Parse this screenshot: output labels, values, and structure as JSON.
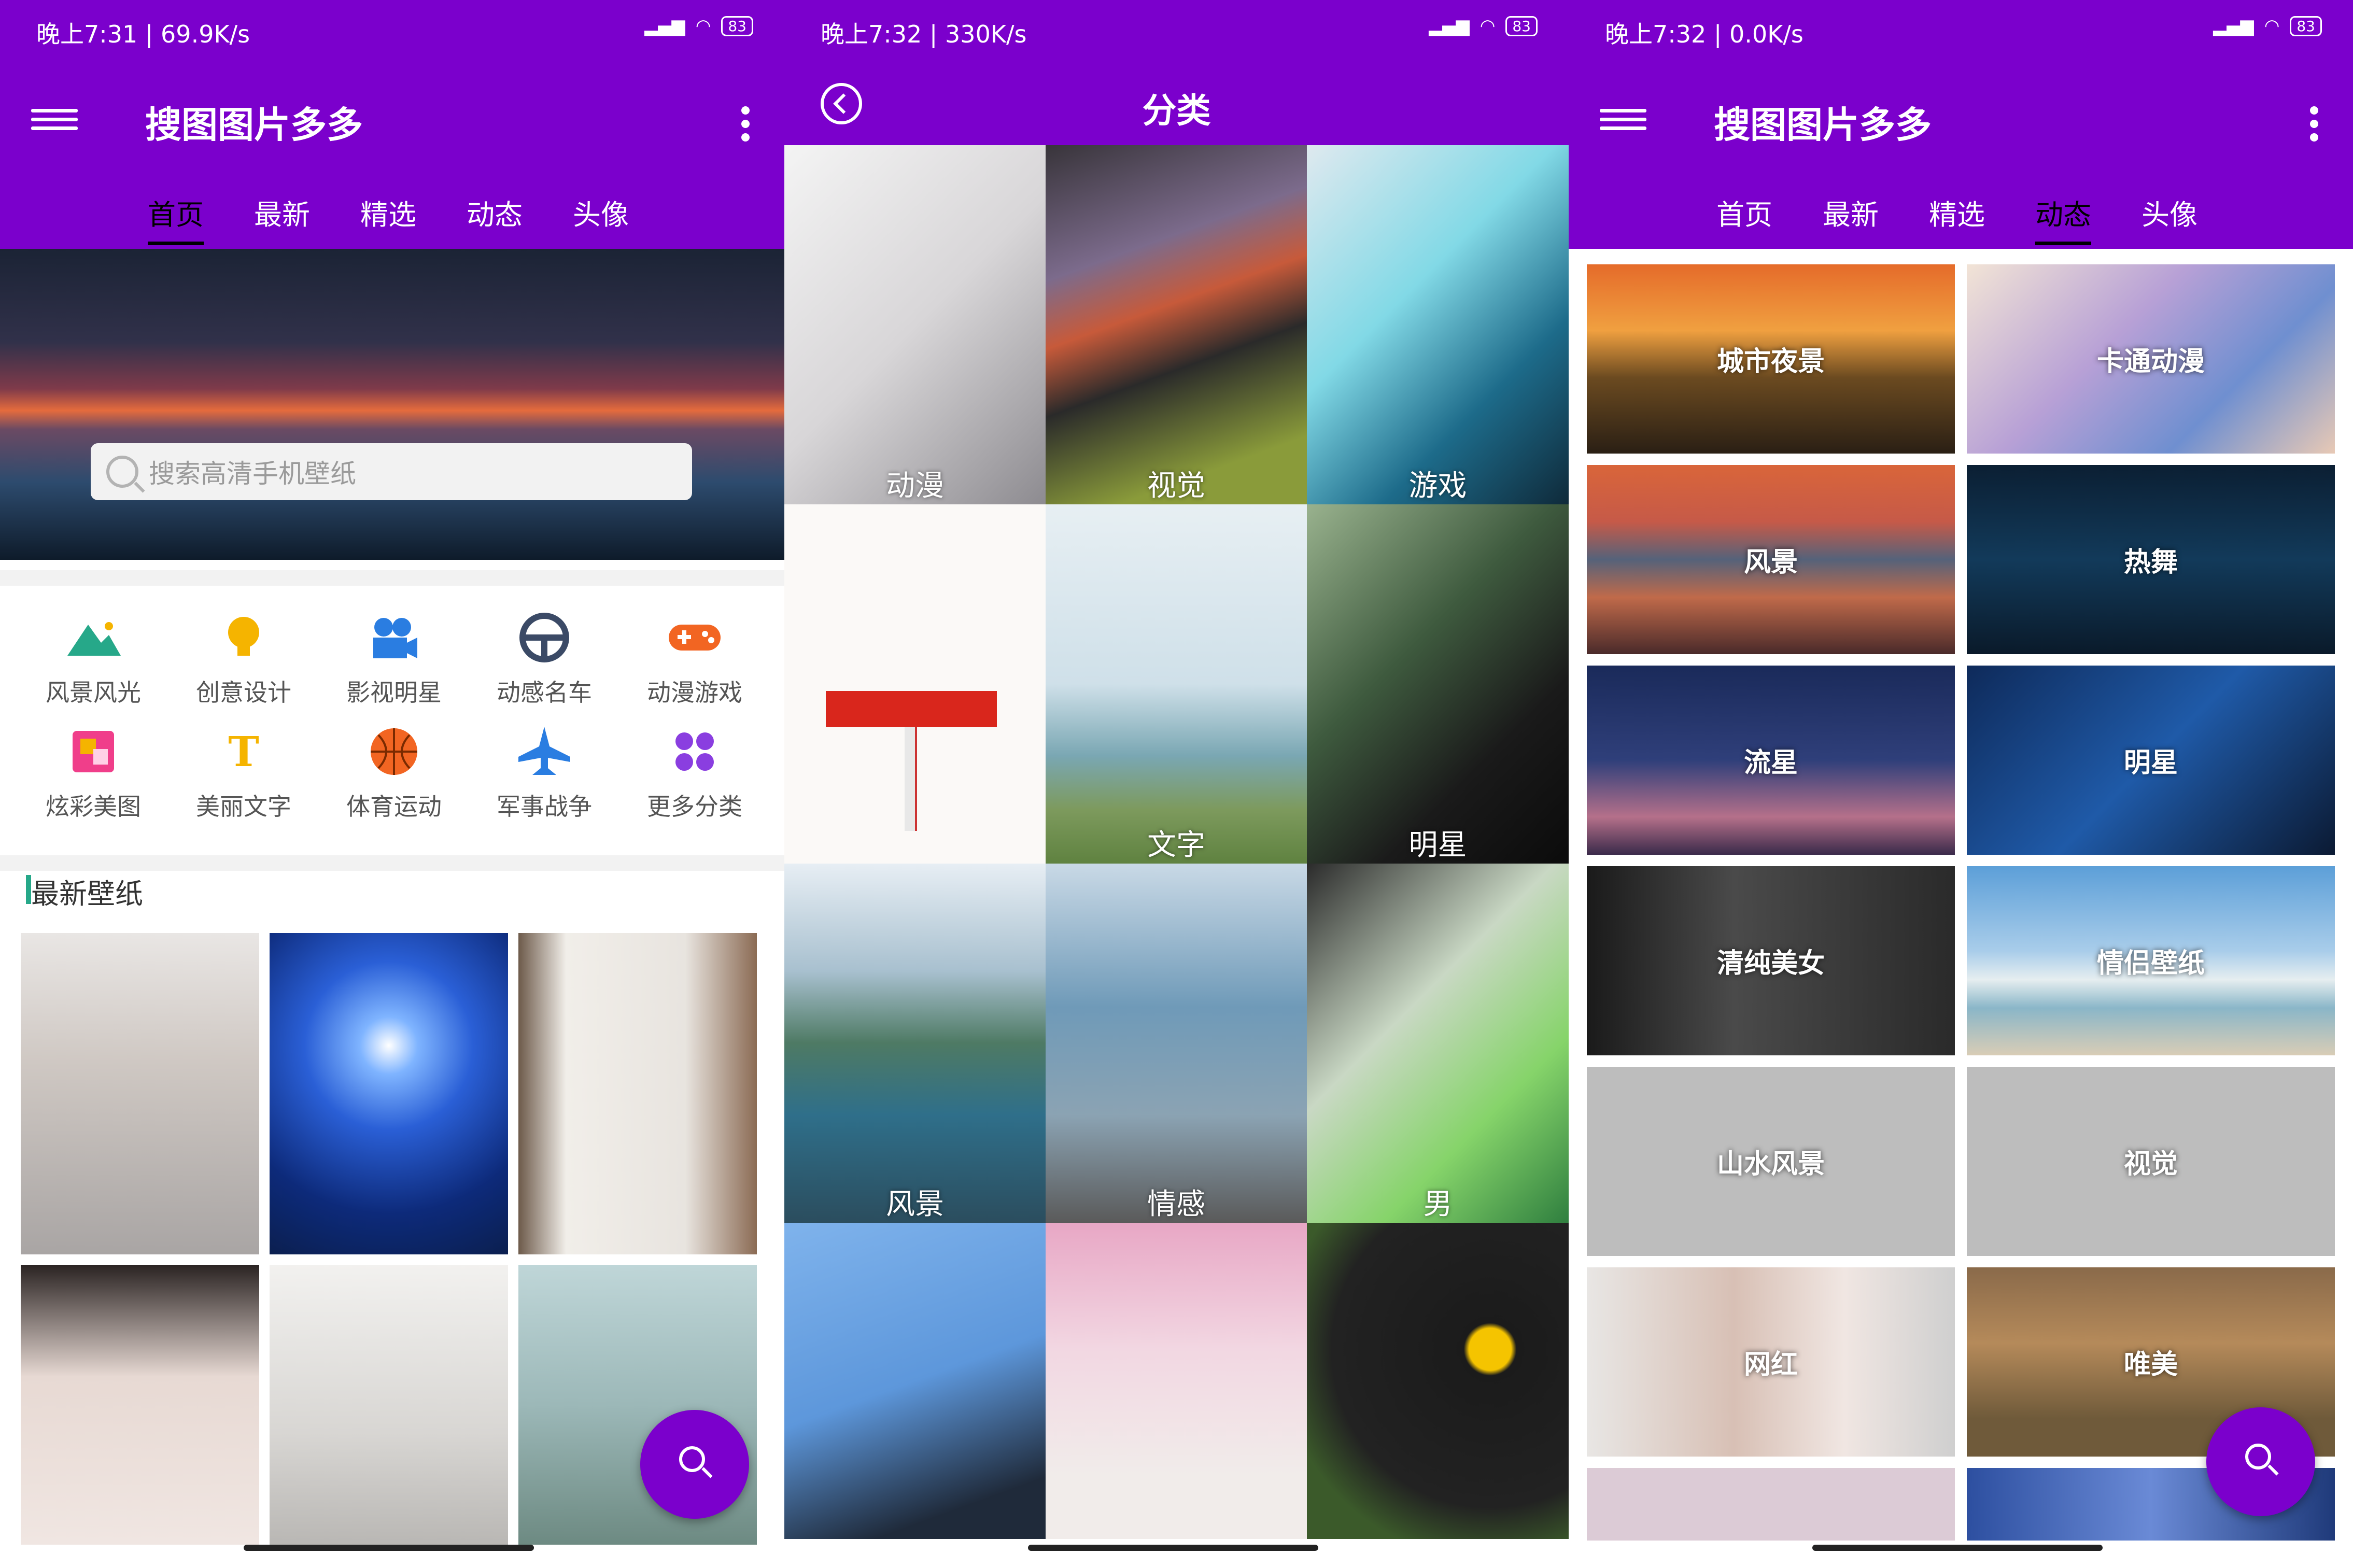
{
  "screens": [
    {
      "status": {
        "time": "晚上7:31 | 69.9K/s",
        "battery": "83"
      },
      "app_title": "搜图图片多多",
      "tabs": [
        "首页",
        "最新",
        "精选",
        "动态",
        "头像"
      ],
      "active_tab": 0,
      "search_placeholder": "搜索高清手机壁纸",
      "categories": [
        {
          "label": "风景风光",
          "icon": "mountain-icon",
          "color": "#26a889"
        },
        {
          "label": "创意设计",
          "icon": "lightbulb-icon",
          "color": "#f5b400"
        },
        {
          "label": "影视明星",
          "icon": "movie-camera-icon",
          "color": "#2a7de1"
        },
        {
          "label": "动感名车",
          "icon": "steering-wheel-icon",
          "color": "#3b4a66"
        },
        {
          "label": "动漫游戏",
          "icon": "gamepad-icon",
          "color": "#f26522"
        },
        {
          "label": "炫彩美图",
          "icon": "color-square-icon",
          "color": "#f03e8a"
        },
        {
          "label": "美丽文字",
          "icon": "text-t-icon",
          "color": "#f5b400"
        },
        {
          "label": "体育运动",
          "icon": "basketball-icon",
          "color": "#f26522"
        },
        {
          "label": "军事战争",
          "icon": "jet-icon",
          "color": "#2a7de1"
        },
        {
          "label": "更多分类",
          "icon": "four-dots-icon",
          "color": "#8a3ee0"
        }
      ],
      "section_title": "最新壁纸"
    },
    {
      "status": {
        "time": "晚上7:32 | 330K/s",
        "battery": "83"
      },
      "title": "分类",
      "tiles": [
        "动漫",
        "视觉",
        "游戏",
        "",
        "文字",
        "明星",
        "风景",
        "情感",
        "男",
        "",
        "",
        ""
      ]
    },
    {
      "status": {
        "time": "晚上7:32 | 0.0K/s",
        "battery": "83"
      },
      "app_title": "搜图图片多多",
      "tabs": [
        "首页",
        "最新",
        "精选",
        "动态",
        "头像"
      ],
      "active_tab": 3,
      "tiles": [
        "城市夜景",
        "卡通动漫",
        "风景",
        "热舞",
        "流星",
        "明星",
        "清纯美女",
        "情侣壁纸",
        "山水风景",
        "视觉",
        "网红",
        "唯美"
      ]
    }
  ],
  "colors": {
    "primary": "#7b00cc",
    "accent_bar": "#26a889"
  }
}
